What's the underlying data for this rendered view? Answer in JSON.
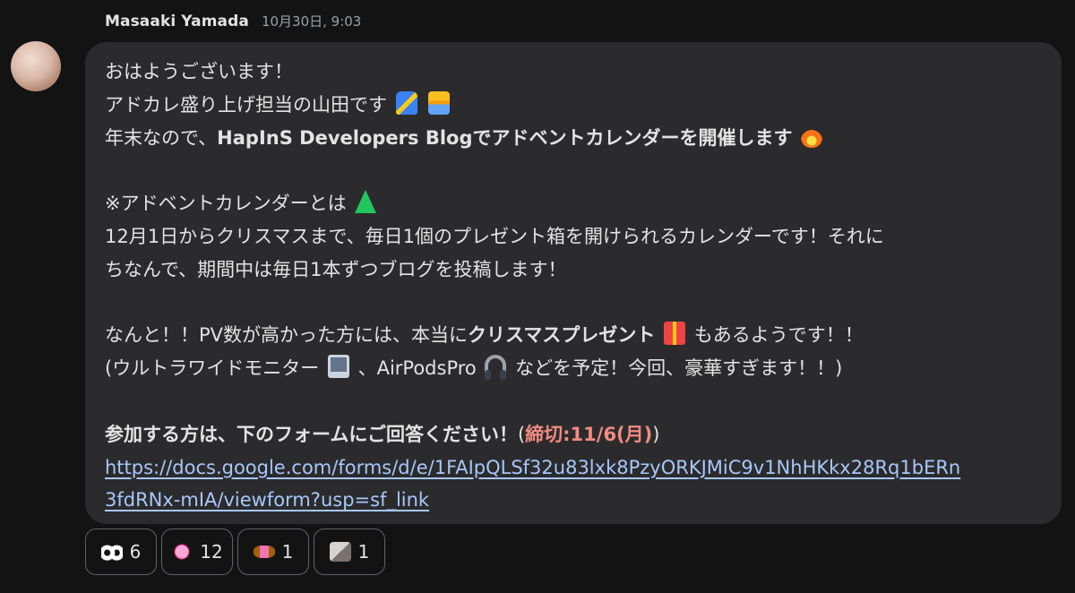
{
  "message": {
    "sender": "Masaaki Yamada",
    "timestamp": "10月30日, 9:03",
    "lines": [
      "おはようございます！",
      "アドカレ盛り上げ担当の山田です",
      "年末なので、",
      "HapInS Developers Blogでアドベントカレンダーを開催します",
      "※アドベントカレンダーとは",
      "12月1日からクリスマスまで、毎日1個のプレゼント箱を開けられるカレンダーです！それに",
      "ちなんで、期間中は毎日1本ずつブログを投稿します！",
      "なんと！！PV数が高かった方には、本当に",
      "クリスマスプレゼント",
      "もあるようです！！",
      "(ウルトラワイドモニター",
      "、AirPodsPro",
      "などを予定！今回、豪華すぎます！！)",
      "参加する方は、下のフォームにご回答ください！",
      "(",
      "締切:11/6(月)",
      ")"
    ],
    "link": {
      "line1": "https://docs.google.com/forms/d/e/1FAIpQLSf32u83lxk8PzyORKJMiC9v1NhHKkx28Rq1bERn",
      "line2": "3fdRNx-mIA/viewform?usp=sf_link"
    }
  },
  "emojis": [
    "tank-top",
    "sunrise",
    "fire",
    "christmas-tree",
    "gift",
    "desktop-monitor",
    "headphones"
  ],
  "reactions": [
    {
      "icon": "eyes",
      "count": "6"
    },
    {
      "icon": "pig-sticker",
      "count": "12"
    },
    {
      "icon": "hands-sticker",
      "count": "1"
    },
    {
      "icon": "person-sticker",
      "count": "1"
    }
  ],
  "colors": {
    "background": "#131314",
    "bubble": "#2b2b2d",
    "link": "#a8c7fa",
    "deadline": "#f28b82"
  }
}
